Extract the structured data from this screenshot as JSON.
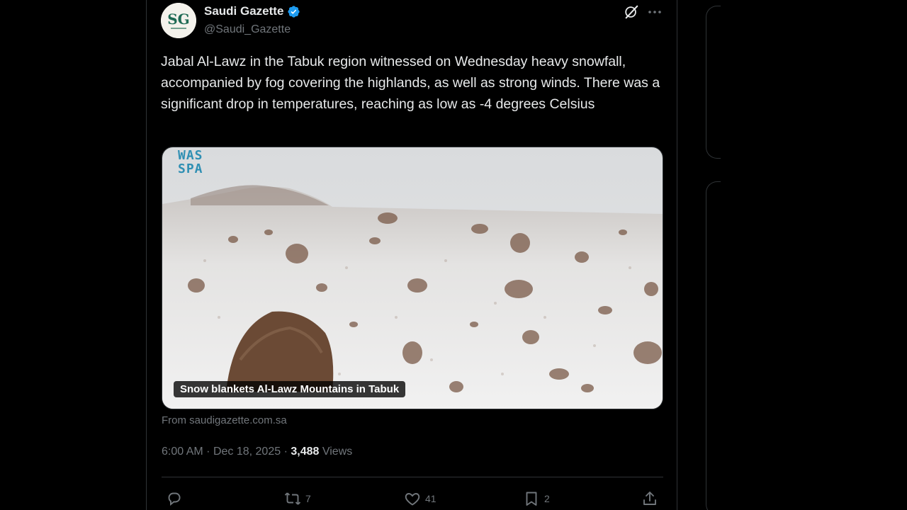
{
  "post": {
    "author_name": "Saudi Gazette",
    "handle": "@Saudi_Gazette",
    "avatar_text": "SG",
    "text": "Jabal Al-Lawz in the Tabuk region witnessed on Wednesday heavy snowfall, accompanied by fog covering the highlands, as well as strong winds. There was a significant drop in temperatures, reaching as low as -4 degrees Celsius",
    "media": {
      "watermark_line1": "WAS",
      "watermark_line2": "SPA",
      "caption": "Snow blankets Al-Lawz Mountains in Tabuk"
    },
    "source": "From saudigazette.com.sa",
    "time": "6:00 AM",
    "separator": "·",
    "date": "Dec 18, 2025",
    "views_count": "3,488",
    "views_label": "Views",
    "actions": {
      "reply_count": "",
      "repost_count": "7",
      "like_count": "41",
      "bookmark_count": "2"
    }
  },
  "icons": {
    "verified": "verified-badge-icon",
    "grok": "grok-icon",
    "more": "more-icon",
    "reply": "reply-icon",
    "repost": "repost-icon",
    "like": "like-icon",
    "bookmark": "bookmark-icon",
    "share": "share-icon"
  },
  "colors": {
    "background": "#000000",
    "text_primary": "#e7e9ea",
    "text_secondary": "#71767b",
    "border": "#2f3336",
    "verified": "#1d9bf0",
    "watermark": "#2f8fb3"
  }
}
